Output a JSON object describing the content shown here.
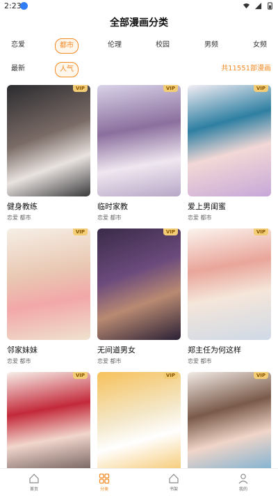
{
  "status": {
    "time": "2:23"
  },
  "header": {
    "title": "全部漫画分类"
  },
  "filters": {
    "row1": [
      "恋爱",
      "都市",
      "伦理",
      "校园",
      "男频",
      "女频"
    ],
    "row1_active": "都市",
    "row2": [
      "最新",
      "人气"
    ],
    "row2_active": "人气",
    "total": "共11551部漫画"
  },
  "colors": {
    "accent": "#f28a24",
    "vip_bg": "#f3cc76"
  },
  "comics": [
    {
      "title": "健身教练",
      "tags": "恋爱 都市",
      "vip": "VIP"
    },
    {
      "title": "临时家教",
      "tags": "恋爱 都市",
      "vip": "VIP"
    },
    {
      "title": "爱上男闺蜜",
      "tags": "恋爱 都市",
      "vip": "VIP"
    },
    {
      "title": "邻家妹妹",
      "tags": "恋爱 都市",
      "vip": "VIP"
    },
    {
      "title": "无间道男女",
      "tags": "恋爱 都市",
      "vip": "VIP"
    },
    {
      "title": "郑主任为何这样",
      "tags": "恋爱 都市",
      "vip": "VIP"
    },
    {
      "title": "",
      "tags": "",
      "vip": "VIP"
    },
    {
      "title": "",
      "tags": "",
      "vip": "VIP"
    },
    {
      "title": "",
      "tags": "",
      "vip": "VIP"
    }
  ],
  "nav": [
    {
      "label": "首页",
      "icon": "home-icon"
    },
    {
      "label": "分类",
      "icon": "category-icon"
    },
    {
      "label": "书架",
      "icon": "bookshelf-icon"
    },
    {
      "label": "我的",
      "icon": "profile-icon"
    }
  ]
}
